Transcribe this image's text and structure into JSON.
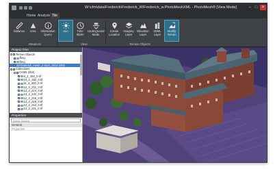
{
  "window": {
    "title": "W:\\cfm\\data\\Frederick\\Frederick_W\\Frederick_w.PhotoMeshXML - PhotoMesh® [View Mode]",
    "controls": [
      "–",
      "□",
      "×"
    ]
  },
  "menu_tabs": [
    {
      "label": "Home",
      "active": false
    },
    {
      "label": "Analysis",
      "active": false
    },
    {
      "label": "Tile",
      "active": true
    }
  ],
  "ribbon": {
    "buttons": [
      {
        "label": "Distance",
        "icon": "ruler-icon"
      },
      {
        "label": "Area",
        "icon": "area-icon"
      },
      {
        "label": "Information Query",
        "icon": "information-icon"
      },
      {
        "label": "Sun",
        "icon": "sun-icon",
        "selected": true
      },
      {
        "label": "Time Slider",
        "icon": "clock-icon"
      },
      {
        "label": "Underground Mode",
        "icon": "underground-icon"
      },
      {
        "label": "Create Location",
        "icon": "location-pin-icon"
      },
      {
        "label": "Imagery Layer",
        "icon": "layers-icon"
      },
      {
        "label": "Elevation Layer",
        "icon": "elevation-icon"
      },
      {
        "label": "3DML Layer",
        "icon": "3dml-icon"
      },
      {
        "label": "Modify Terrain",
        "icon": "modify-terrain-icon",
        "selected": true
      }
    ],
    "groups": {
      "measure": "Measure",
      "view": "View",
      "terrain_objects": "Terrain Objects"
    }
  },
  "project_tree": {
    "header": "Project Tree",
    "rows": [
      {
        "label": "Terrain Objects",
        "depth": 0
      },
      {
        "label": "fbng",
        "depth": 1
      },
      {
        "label": "fbng",
        "depth": 1
      },
      {
        "label": "Frederick_mesh_2 Som_2014.1001",
        "depth": 1,
        "selected": true
      },
      {
        "label": "Collections",
        "depth": 0
      },
      {
        "label": "CAMs (252)",
        "depth": 1
      },
      {
        "label": "6_2_192_0.tif",
        "depth": 2
      },
      {
        "label": "10_2_182_0.tif",
        "depth": 2
      },
      {
        "label": "11_2_200_0.tif",
        "depth": 2
      },
      {
        "label": "12_2_212_0.tif",
        "depth": 2
      },
      {
        "label": "13_2_214_0.tif",
        "depth": 2
      },
      {
        "label": "13_2_242_0.tif",
        "depth": 2
      },
      {
        "label": "12_2_216_0.tif",
        "depth": 2
      },
      {
        "label": "13_2_218_0.tif",
        "depth": 2
      },
      {
        "label": "12_2_212_0.tif",
        "depth": 2
      },
      {
        "label": "13_2_211_0.tif",
        "depth": 2
      }
    ]
  },
  "properties": {
    "header": "Properties",
    "search_placeholder": "Quick Search",
    "general_label": "General",
    "property_label": "Properties"
  }
}
